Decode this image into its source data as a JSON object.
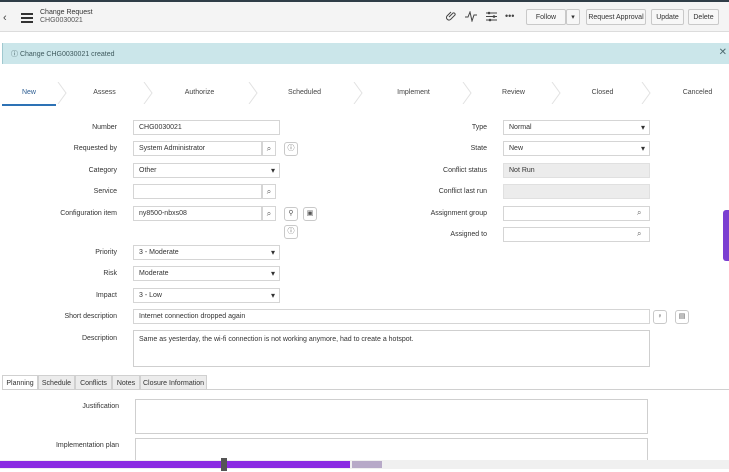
{
  "header": {
    "back_glyph": "‹",
    "title": "Change Request",
    "number": "CHG0030021",
    "buttons": {
      "follow": "Follow",
      "request_approval": "Request Approval",
      "update": "Update",
      "delete": "Delete"
    }
  },
  "notice": {
    "text": "Change CHG0030021 created"
  },
  "stages": [
    "New",
    "Assess",
    "Authorize",
    "Scheduled",
    "Implement",
    "Review",
    "Closed",
    "Canceled"
  ],
  "form": {
    "number_label": "Number",
    "number_value": "CHG0030021",
    "requested_by_label": "Requested by",
    "requested_by_value": "System Administrator",
    "category_label": "Category",
    "category_value": "Other",
    "service_label": "Service",
    "service_value": "",
    "ci_label": "Configuration item",
    "ci_value": "ny8500-nbxs08",
    "priority_label": "Priority",
    "priority_value": "3 - Moderate",
    "risk_label": "Risk",
    "risk_value": "Moderate",
    "impact_label": "Impact",
    "impact_value": "3 - Low",
    "short_desc_label": "Short description",
    "short_desc_value": "Internet connection dropped again",
    "description_label": "Description",
    "description_value": "Same as yesterday, the wi-fi connection is not working anymore, had to create a hotspot.",
    "type_label": "Type",
    "type_value": "Normal",
    "state_label": "State",
    "state_value": "New",
    "conflict_status_label": "Conflict status",
    "conflict_status_value": "Not Run",
    "conflict_last_run_label": "Conflict last run",
    "conflict_last_run_value": "",
    "assignment_group_label": "Assignment group",
    "assignment_group_value": "",
    "assigned_to_label": "Assigned to",
    "assigned_to_value": ""
  },
  "tabs": [
    "Planning",
    "Schedule",
    "Conflicts",
    "Notes",
    "Closure Information"
  ],
  "planning": {
    "justification_label": "Justification",
    "implementation_plan_label": "Implementation plan"
  },
  "colors": {
    "accent": "#2d72b5",
    "notice_bg": "#cbe6ea",
    "progress": "#8a2be2"
  },
  "progress": {
    "fraction": 0.48
  }
}
